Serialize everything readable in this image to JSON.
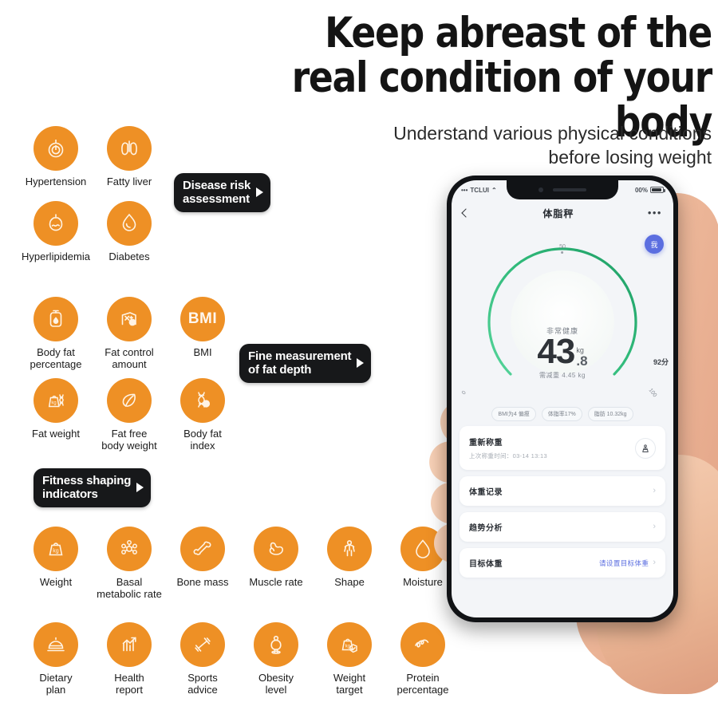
{
  "headline": "Keep abreast of the\nreal condition of your body",
  "subhead": "Understand various physical conditions\nbefore losing weight",
  "brand": {
    "orange": "#ee9025",
    "black": "#17181a",
    "accent_blue": "#5b6ee0",
    "gauge_green": "#2fb979"
  },
  "groups": [
    {
      "name": "disease-risk",
      "tag": {
        "label": "Disease risk\nassessment"
      },
      "items": [
        {
          "label": "Hypertension",
          "icon": "blood-pressure-icon"
        },
        {
          "label": "Fatty liver",
          "icon": "lungs-icon"
        },
        {
          "label": "Hyperlipidemia",
          "icon": "flask-icon"
        },
        {
          "label": "Diabetes",
          "icon": "blood-drop-icon"
        }
      ]
    },
    {
      "name": "fat-depth",
      "tag": {
        "label": "Fine measurement\nof fat depth"
      },
      "items": [
        {
          "label": "Body fat\npercentage",
          "icon": "fat-bag-icon"
        },
        {
          "label": "Fat control\namount",
          "icon": "fat-control-icon"
        },
        {
          "label": "BMI",
          "icon": "bmi-text-icon"
        },
        {
          "label": "Fat weight",
          "icon": "kg-bag-dna-icon"
        },
        {
          "label": "Fat free\nbody weight",
          "icon": "leaf-icon"
        },
        {
          "label": "Body fat\nindex",
          "icon": "dna-icon"
        }
      ]
    },
    {
      "name": "fitness-shaping",
      "tag": {
        "label": "Fitness shaping\nindicators"
      },
      "items": [
        {
          "label": "Weight",
          "icon": "kg-weight-icon"
        },
        {
          "label": "Basal\nmetabolic rate",
          "icon": "molecule-icon"
        },
        {
          "label": "Bone mass",
          "icon": "bone-icon"
        },
        {
          "label": "Muscle rate",
          "icon": "muscle-icon"
        },
        {
          "label": "Shape",
          "icon": "body-shape-icon"
        },
        {
          "label": "Moisture",
          "icon": "water-drop-icon"
        },
        {
          "label": "Dietary\nplan",
          "icon": "food-cloche-icon"
        },
        {
          "label": "Health\nreport",
          "icon": "bar-chart-arrow-icon"
        },
        {
          "label": "Sports\nadvice",
          "icon": "dumbbell-icon"
        },
        {
          "label": "Obesity\nlevel",
          "icon": "obese-person-icon"
        },
        {
          "label": "Weight\ntarget",
          "icon": "kg-bag-check-icon"
        },
        {
          "label": "Protein\npercentage",
          "icon": "protein-squiggle-icon"
        }
      ]
    }
  ],
  "phone": {
    "status_bar": {
      "carrier": "TCLUI",
      "signal": "signal-icon",
      "battery_pct": "00%"
    },
    "nav": {
      "back": "back-chevron-icon",
      "title": "体脂秤",
      "more": "more-dots-icon"
    },
    "avatar_label": "我",
    "gauge": {
      "status": "非常健康",
      "integer": "43",
      "decimal": ".8",
      "unit": "kg",
      "sub": "需减重 4.45 kg",
      "score": "92分",
      "tick_top": "50",
      "tick_left": "0",
      "tick_right": "100"
    },
    "chips": [
      "BMI为4 偏瘦",
      "体脂率17%",
      "脂肪 10.32kg"
    ],
    "rows": [
      {
        "title": "重新称重",
        "sub": "上次称重时间：03-14 13:13",
        "action_icon": "scale-icon"
      },
      {
        "title": "体重记录",
        "chevron": "›"
      },
      {
        "title": "趋势分析",
        "chevron": "›"
      },
      {
        "title": "目标体重",
        "link": "请设置目标体重",
        "chevron": "›"
      }
    ]
  }
}
